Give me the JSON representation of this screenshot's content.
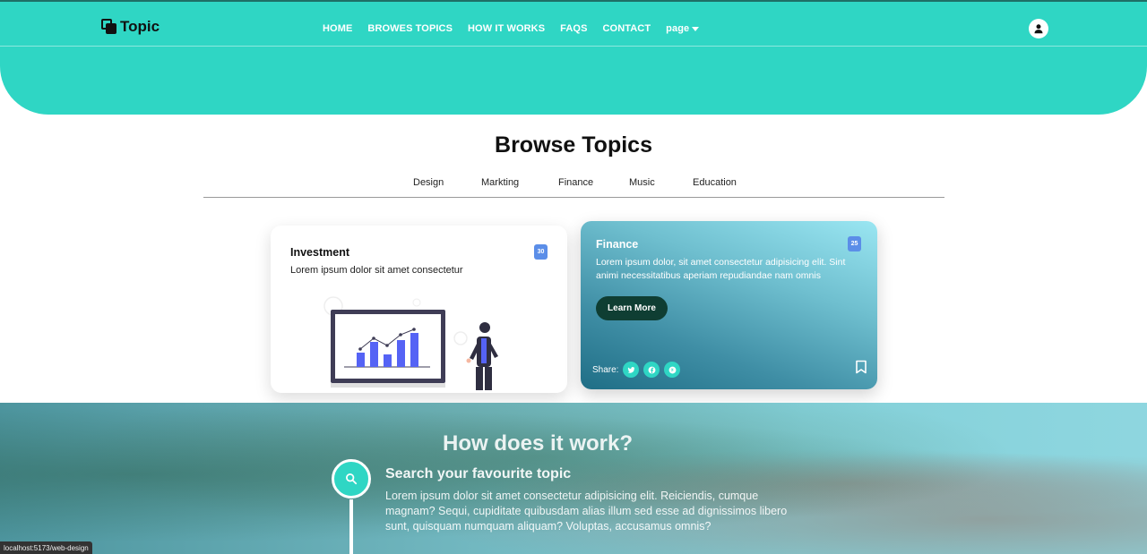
{
  "header": {
    "brand": "Topic",
    "nav": [
      {
        "label": "HOME",
        "name": "nav-home"
      },
      {
        "label": "BROWES TOPICS",
        "name": "nav-browse-topics"
      },
      {
        "label": "HOW IT WORKS",
        "name": "nav-how-it-works"
      },
      {
        "label": "FAQS",
        "name": "nav-faqs"
      },
      {
        "label": "CONTACT",
        "name": "nav-contact"
      }
    ],
    "page_menu": "page",
    "accent_color": "#2fd6c4"
  },
  "browse": {
    "title": "Browse Topics",
    "tabs": [
      "Design",
      "Markting",
      "Finance",
      "Music",
      "Education"
    ]
  },
  "cards": {
    "investment": {
      "title": "Investment",
      "description": "Lorem ipsum dolor sit amet consectetur",
      "count": "30"
    },
    "finance": {
      "title": "Finance",
      "description": "Lorem ipsum dolor, sit amet consectetur adipisicing elit. Sint animi necessitatibus aperiam repudiandae nam omnis",
      "count": "25",
      "button": "Learn More",
      "share_label": "Share:"
    }
  },
  "how": {
    "title": "How does it work?",
    "step_title": "Search your favourite topic",
    "step_desc": "Lorem ipsum dolor sit amet consectetur adipisicing elit. Reiciendis, cumque magnam? Sequi, cupiditate quibusdam alias illum sed esse ad dignissimos libero sunt, quisquam numquam aliquam? Voluptas, accusamus omnis?"
  },
  "status_bar": "localhost:5173/web-design"
}
